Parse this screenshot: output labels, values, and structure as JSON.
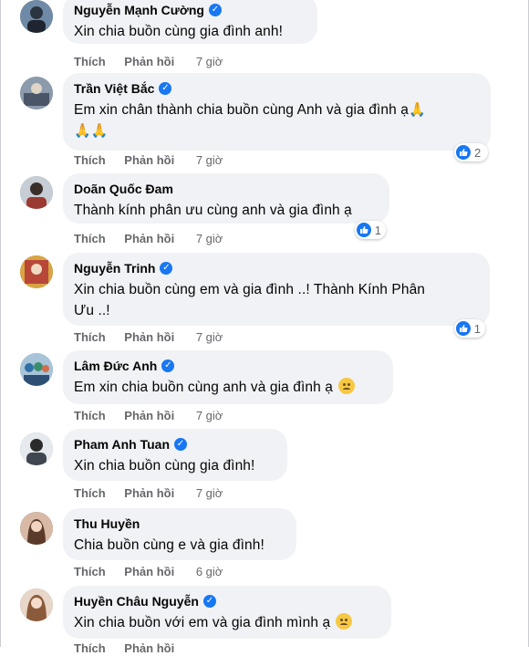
{
  "actions": {
    "like": "Thích",
    "reply": "Phản hồi"
  },
  "comments": [
    {
      "name": "Nguyễn Mạnh Cường",
      "verified": true,
      "text": "Xin chia buồn cùng gia đình anh!",
      "time": "7 giờ"
    },
    {
      "name": "Trần Việt Bắc",
      "verified": true,
      "text": "Em xin chân thành chia buồn cùng Anh và gia đình ạ",
      "emoji_line1": "🙏",
      "emoji_line2": "🙏🙏",
      "time": "7 giờ",
      "reactions": "2"
    },
    {
      "name": "Doãn Quốc Đam",
      "verified": false,
      "text": "Thành kính phân ưu cùng anh và gia đình ạ",
      "time": "7 giờ",
      "reactions": "1"
    },
    {
      "name": "Nguyễn Trinh",
      "verified": true,
      "text_line1": "Xin chia buồn cùng em và gia đình ..! Thành Kính Phân",
      "text_line2": "Ưu ..!",
      "time": "7 giờ",
      "reactions": "1"
    },
    {
      "name": "Lâm Đức Anh",
      "verified": true,
      "text": "Em xin chia buồn cùng anh và gia đình ạ",
      "emoji": "sad-face",
      "time": "7 giờ"
    },
    {
      "name": "Pham Anh Tuan",
      "verified": true,
      "text": "Xin chia buồn cùng gia đình!",
      "time": "7 giờ"
    },
    {
      "name": "Thu Huyền",
      "verified": false,
      "text": "Chia buồn cùng e và gia đình!",
      "time": "6 giờ"
    },
    {
      "name": "Huyền Châu Nguyễn",
      "verified": true,
      "text": "Xin chia buồn với em và gia đình mình ạ",
      "emoji": "sad-face",
      "time": ""
    }
  ],
  "colors": {
    "accent": "#1877f2",
    "bubble": "#f0f2f5",
    "muted": "#65676b"
  }
}
